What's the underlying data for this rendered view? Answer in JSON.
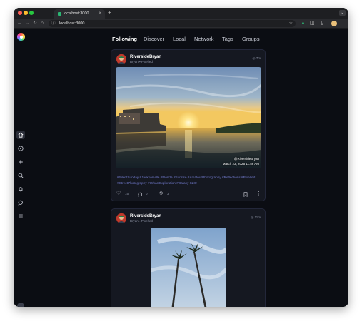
{
  "browser": {
    "tab_title": "localhost:3000",
    "tab_close": "×",
    "new_tab": "+",
    "tab_menu": "⌄",
    "url": "localhost:3000",
    "icons": [
      "back-icon",
      "forward-icon",
      "reload-icon",
      "home-icon",
      "site-info-icon",
      "bookmark-star-icon",
      "extension-icon",
      "download-icon",
      "menu-icon"
    ]
  },
  "nav": {
    "tabs": [
      {
        "label": "Following",
        "active": true
      },
      {
        "label": "Discover",
        "active": false
      },
      {
        "label": "Local",
        "active": false
      },
      {
        "label": "Network",
        "active": false
      },
      {
        "label": "Tags",
        "active": false
      },
      {
        "label": "Groups",
        "active": false
      }
    ]
  },
  "sidebar": {
    "items": [
      "home-icon",
      "compass-icon",
      "plus-icon",
      "search-icon",
      "bell-icon",
      "chat-icon",
      "menu-icon"
    ],
    "active": "home-icon"
  },
  "posts": [
    {
      "author": "RiversideBryan",
      "handle": "Bryan",
      "source": "Pixelfed",
      "time": "7m",
      "watermark": "@RiversideBryan",
      "date": "March 23, 2025 11:56 AM",
      "tags": "#SilentSunday #Jacksonville #Florida #Sunrise #AmateurPhotography #Reflections #Pixelfed #StreetPhotography #UrbanExploration #Galaxy S23+",
      "likes": "15",
      "comments": "0",
      "boosts": "3"
    },
    {
      "author": "RiversideBryan",
      "handle": "Bryan",
      "source": "Pixelfed",
      "time": "11m"
    }
  ],
  "colors": {
    "background": "#0b0d13",
    "card": "#151821",
    "accent_tags": "#6f78c9"
  }
}
